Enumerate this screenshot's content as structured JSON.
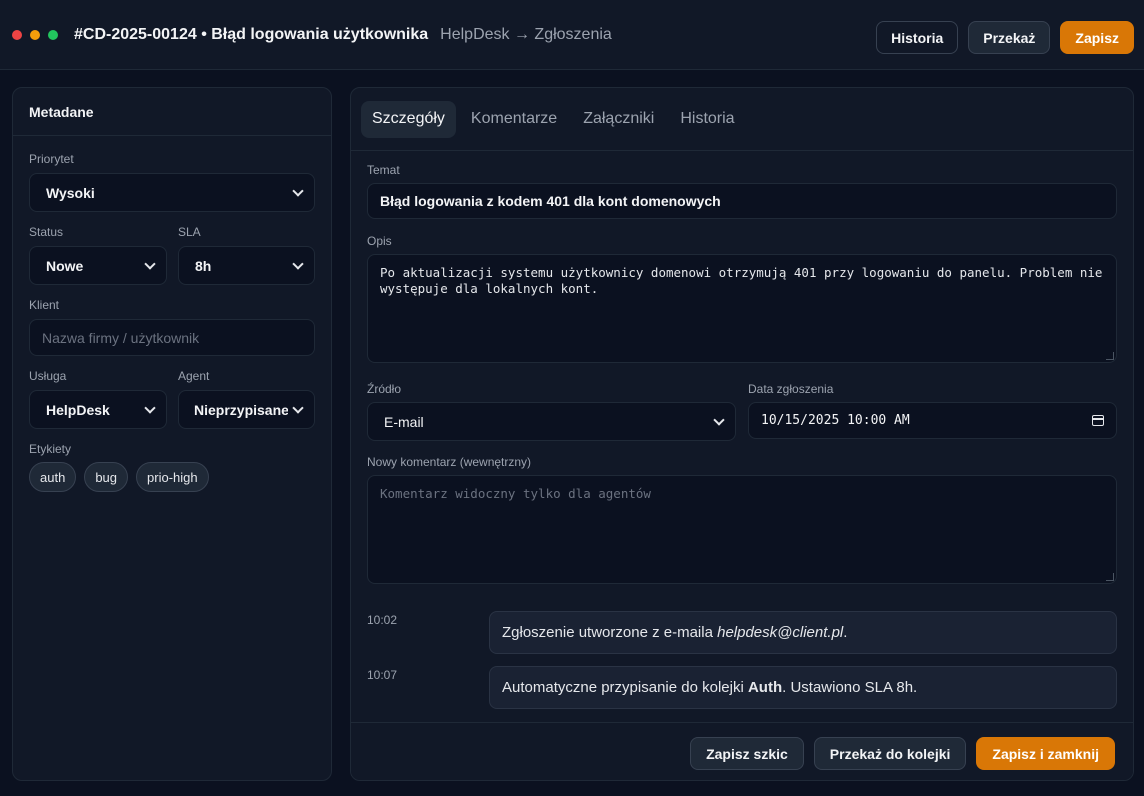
{
  "header": {
    "ticket_title": "#CD-2025-00124 • Błąd logowania użytkownika",
    "breadcrumb": "HelpDesk → Zgłoszenia",
    "history_button": "Historia",
    "forward_button": "Przekaż",
    "save_button": "Zapisz"
  },
  "metadata": {
    "title": "Metadane",
    "priority_label": "Priorytet",
    "priority_value": "Wysoki",
    "status_label": "Status",
    "status_value": "Nowe",
    "sla_label": "SLA",
    "sla_value": "8h",
    "client_label": "Klient",
    "client_placeholder": "Nazwa firmy / użytkownik",
    "service_label": "Usługa",
    "service_value": "HelpDesk",
    "agent_label": "Agent",
    "agent_value": "Nieprzypisane",
    "tags_label": "Etykiety",
    "tags": [
      "auth",
      "bug",
      "prio-high"
    ]
  },
  "tabs": [
    "Szczegóły",
    "Komentarze",
    "Załączniki",
    "Historia"
  ],
  "details": {
    "subject_label": "Temat",
    "subject_value": "Błąd logowania z kodem 401 dla kont domenowych",
    "description_label": "Opis",
    "description_value": "Po aktualizacji systemu użytkownicy domenowi otrzymują 401 przy logowaniu do panelu. Problem nie występuje dla lokalnych kont.",
    "source_label": "Źródło",
    "source_value": "E-mail",
    "date_label": "Data zgłoszenia",
    "date_value": "10/15/2025 10:00 AM",
    "comment_label": "Nowy komentarz (wewnętrzny)",
    "comment_placeholder": "Komentarz widoczny tylko dla agentów"
  },
  "timeline": [
    {
      "time": "10:02",
      "text_before": "Zgłoszenie utworzone z e-maila ",
      "emphasis": "helpdesk@client.pl",
      "text_after": "."
    },
    {
      "time": "10:07",
      "text_before": "Automatyczne przypisanie do kolejki ",
      "emphasis": "Auth",
      "text_after": ". Ustawiono SLA 8h."
    }
  ],
  "footer": {
    "draft_button": "Zapisz szkic",
    "queue_button": "Przekaż do kolejki",
    "save_close_button": "Zapisz i zamknij"
  }
}
